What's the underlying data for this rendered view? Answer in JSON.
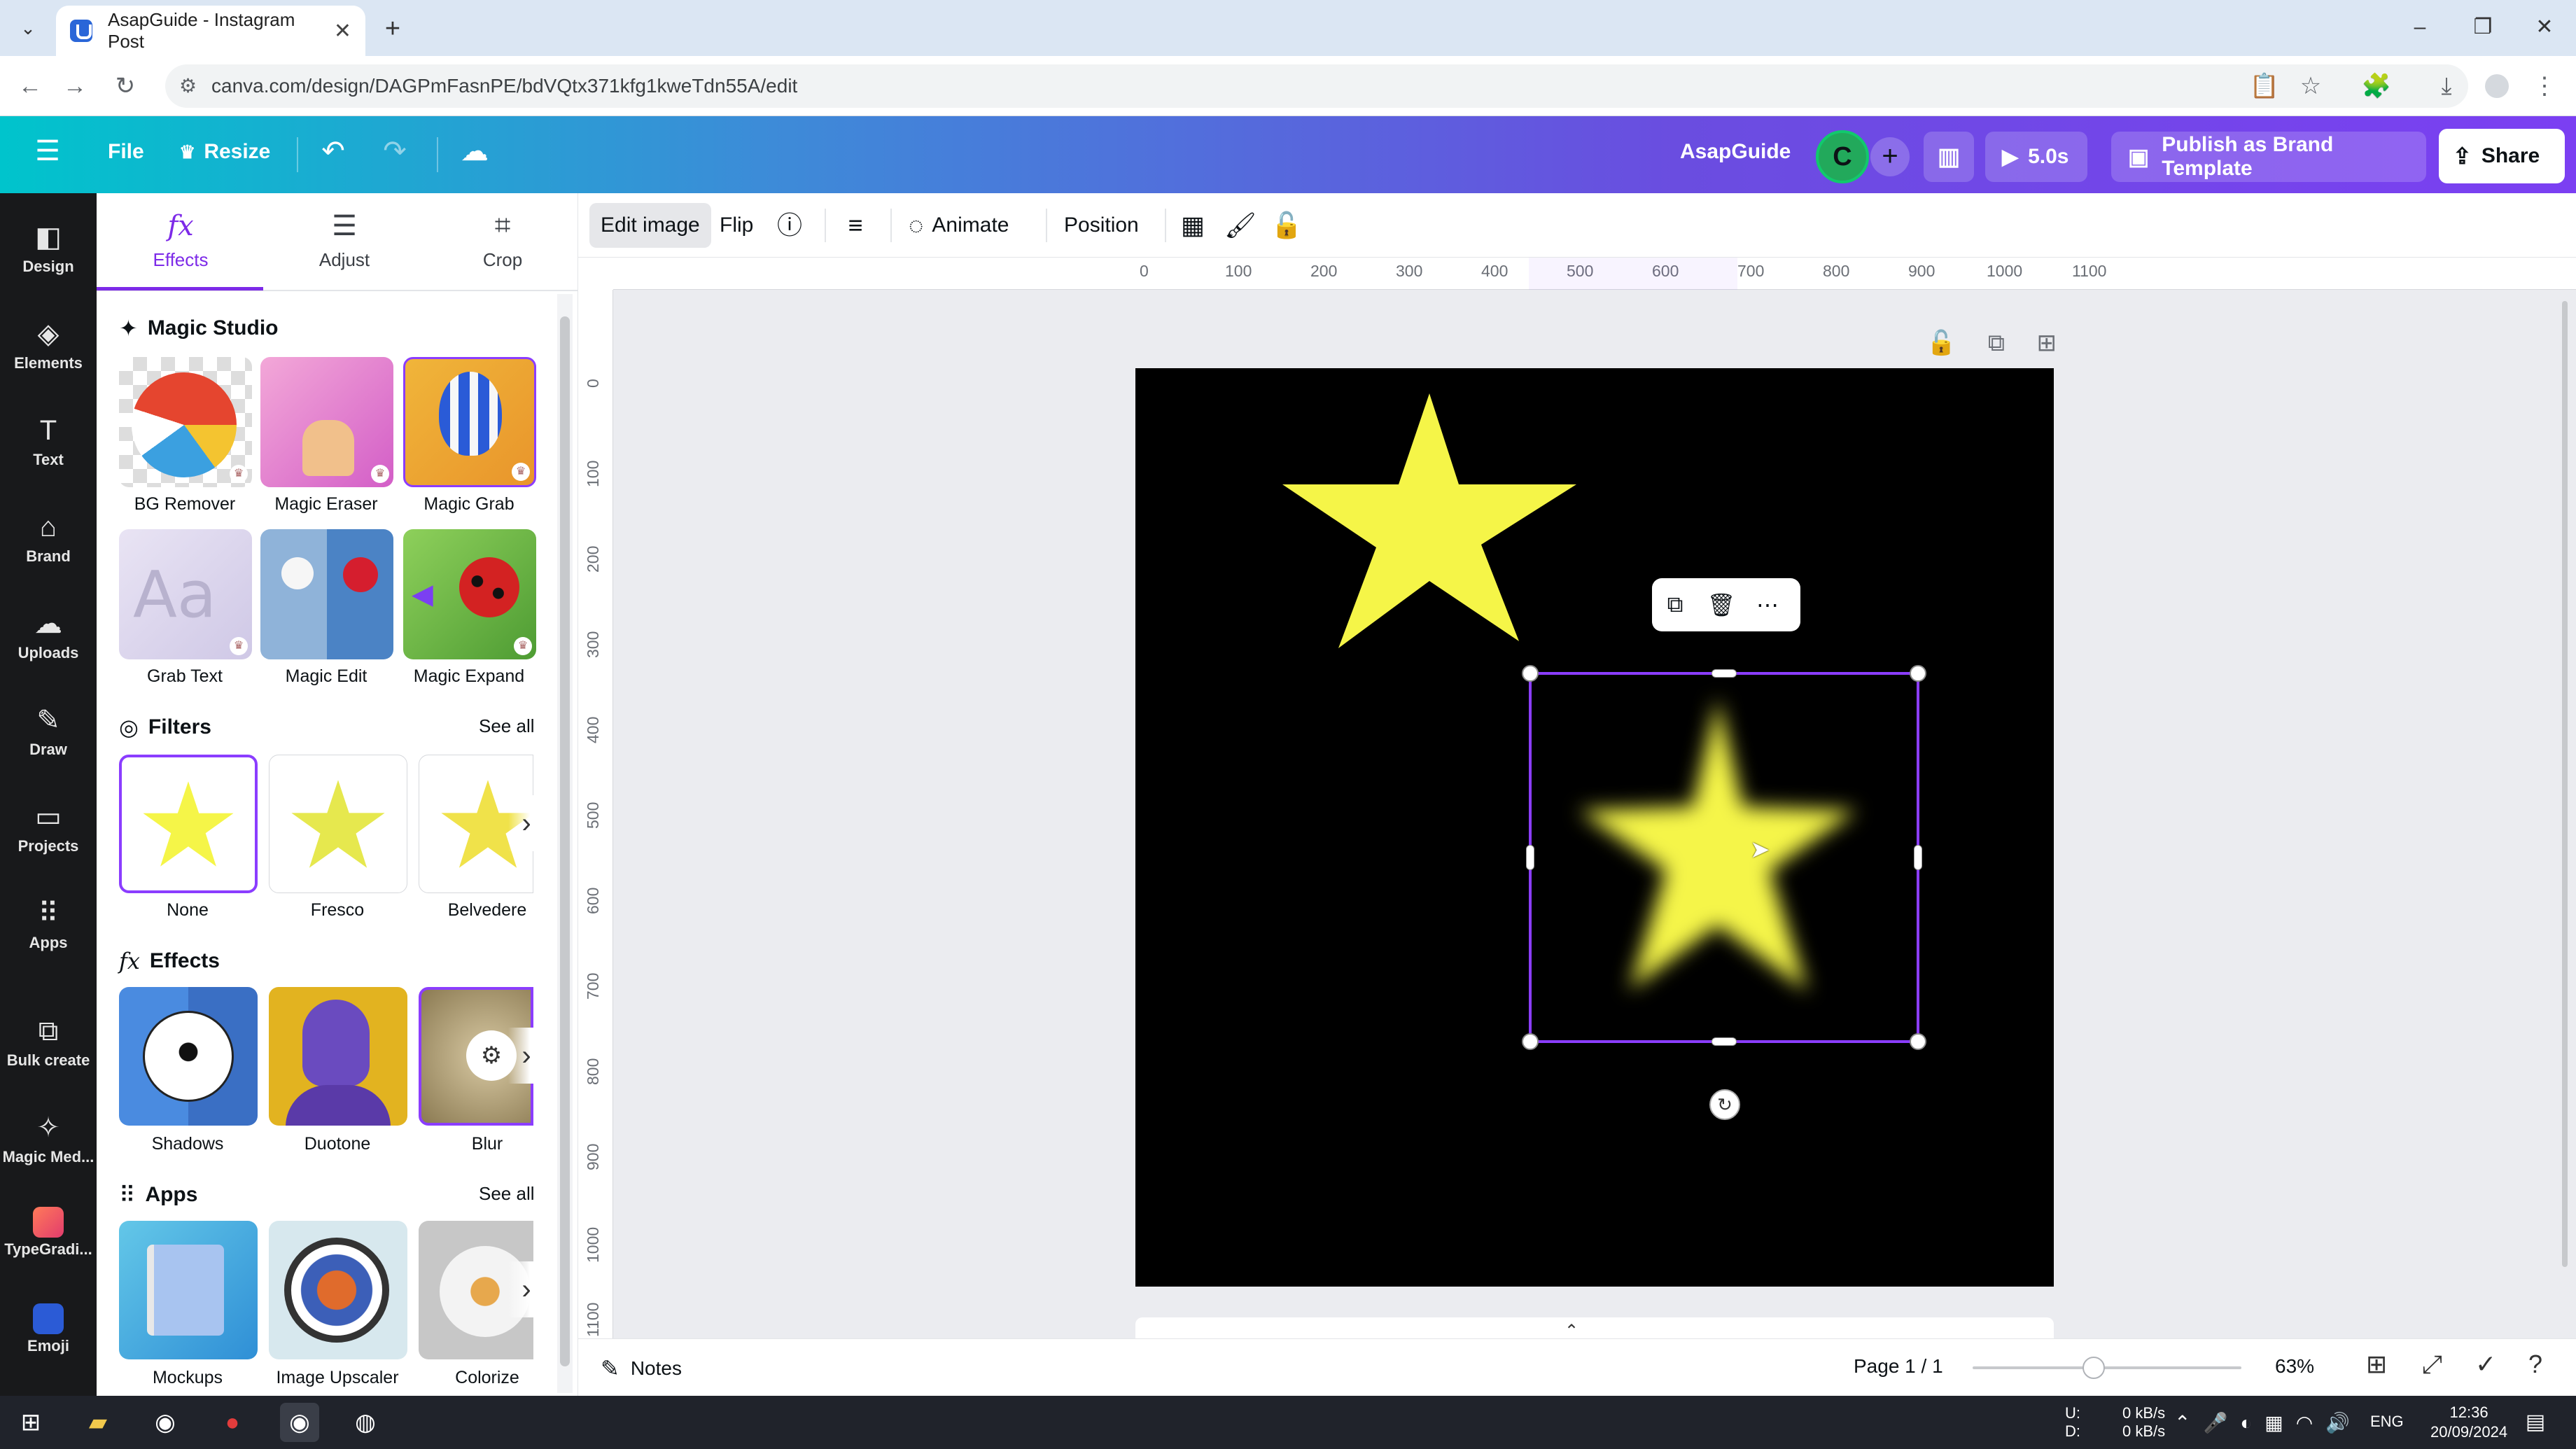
{
  "browser": {
    "tab_title": "AsapGuide - Instagram Post",
    "url": "canva.com/design/DAGPmFasnPE/bdVQtx371kfg1kweTdn55A/edit"
  },
  "topbar": {
    "menu_label": "File",
    "resize_label": "Resize",
    "team_name": "AsapGuide",
    "avatar_initial": "C",
    "play_duration": "5.0s",
    "publish_label": "Publish as Brand Template",
    "share_label": "Share"
  },
  "rail": {
    "items": [
      {
        "label": "Design",
        "icon": "design-icon"
      },
      {
        "label": "Elements",
        "icon": "elements-icon"
      },
      {
        "label": "Text",
        "icon": "text-icon"
      },
      {
        "label": "Brand",
        "icon": "brand-icon"
      },
      {
        "label": "Uploads",
        "icon": "uploads-icon"
      },
      {
        "label": "Draw",
        "icon": "draw-icon"
      },
      {
        "label": "Projects",
        "icon": "projects-icon"
      },
      {
        "label": "Apps",
        "icon": "apps-icon"
      },
      {
        "label": "Bulk create",
        "icon": "bulk-create-icon"
      },
      {
        "label": "Magic Med...",
        "icon": "magic-media-icon"
      },
      {
        "label": "TypeGradi...",
        "icon": "typegradient-icon"
      },
      {
        "label": "Emoji",
        "icon": "emoji-icon"
      }
    ]
  },
  "panel": {
    "tabs": [
      {
        "label": "Effects",
        "active": true
      },
      {
        "label": "Adjust",
        "active": false
      },
      {
        "label": "Crop",
        "active": false
      }
    ],
    "magic_studio": {
      "title": "Magic Studio",
      "tools": [
        "BG Remover",
        "Magic Eraser",
        "Magic Grab",
        "Grab Text",
        "Magic Edit",
        "Magic Expand"
      ]
    },
    "filters": {
      "title": "Filters",
      "see_all": "See all",
      "items": [
        "None",
        "Fresco",
        "Belvedere"
      ]
    },
    "effects": {
      "title": "Effects",
      "items": [
        "Shadows",
        "Duotone",
        "Blur"
      ]
    },
    "apps": {
      "title": "Apps",
      "see_all": "See all",
      "items": [
        "Mockups",
        "Image Upscaler",
        "Colorize"
      ]
    }
  },
  "context_toolbar": {
    "edit_image": "Edit image",
    "flip": "Flip",
    "animate": "Animate",
    "position": "Position"
  },
  "ruler": {
    "horizontal": [
      "0",
      "100",
      "200",
      "300",
      "400",
      "500",
      "600",
      "700",
      "800",
      "900",
      "1000",
      "1100"
    ],
    "vertical": [
      "0",
      "100",
      "200",
      "300",
      "400",
      "500",
      "600",
      "700",
      "800",
      "900",
      "1000",
      "1100"
    ]
  },
  "canvas": {
    "background_color": "#000000",
    "star_color": "#f5f548"
  },
  "footer": {
    "notes_label": "Notes",
    "page_indicator": "Page 1 / 1",
    "zoom_level": "63%",
    "zoom_fraction": 0.45
  },
  "taskbar": {
    "network_up": "0 kB/s",
    "network_down": "0 kB/s",
    "net_up_label": "U:",
    "net_down_label": "D:",
    "language": "ENG",
    "time": "12:36",
    "date": "20/09/2024"
  },
  "colors": {
    "accent": "#8b3dff",
    "rail_bg": "#18191b"
  }
}
